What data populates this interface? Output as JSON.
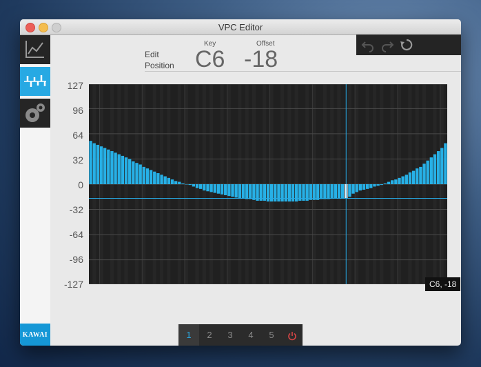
{
  "window": {
    "title": "VPC Editor"
  },
  "header": {
    "edit_label_line1": "Edit",
    "edit_label_line2": "Position",
    "key_label": "Key",
    "key_value": "C6",
    "offset_label": "Offset",
    "offset_value": "-18"
  },
  "sidebar": {
    "items": [
      {
        "icon": "line-graph-icon",
        "active": false
      },
      {
        "icon": "bar-edit-icon",
        "active": true
      },
      {
        "icon": "settings-gears-icon",
        "active": false
      }
    ],
    "logo": "KAWAI"
  },
  "toolbar": {
    "buttons": [
      {
        "icon": "undo-icon"
      },
      {
        "icon": "redo-icon"
      },
      {
        "icon": "reset-icon"
      }
    ]
  },
  "tooltip": "C6, -18",
  "pager": {
    "pages": [
      "1",
      "2",
      "3",
      "4",
      "5"
    ],
    "active": "1",
    "power_icon": "power-icon"
  },
  "colors": {
    "accent": "#27a9e3",
    "plot_bg": "#202020",
    "bar": "#27b0e6",
    "selected_bar": "#ffffff"
  },
  "chart_data": {
    "type": "bar",
    "ylim": [
      -127,
      127
    ],
    "y_ticks": [
      "127",
      "96",
      "64",
      "32",
      "0",
      "-32",
      "-64",
      "-96",
      "-127"
    ],
    "selected_index": 72,
    "values": [
      55,
      52,
      50,
      48,
      46,
      44,
      42,
      40,
      38,
      36,
      34,
      32,
      29,
      27,
      25,
      22,
      20,
      18,
      16,
      14,
      12,
      10,
      8,
      6,
      4,
      3,
      1,
      0,
      -1,
      -3,
      -5,
      -6,
      -8,
      -9,
      -10,
      -11,
      -12,
      -13,
      -14,
      -15,
      -16,
      -17,
      -18,
      -18,
      -19,
      -19,
      -20,
      -21,
      -21,
      -21,
      -22,
      -22,
      -22,
      -22,
      -22,
      -22,
      -22,
      -22,
      -22,
      -21,
      -21,
      -21,
      -20,
      -20,
      -20,
      -19,
      -19,
      -19,
      -18,
      -18,
      -18,
      -18,
      -18,
      -16,
      -12,
      -10,
      -8,
      -7,
      -6,
      -5,
      -3,
      -2,
      -1,
      1,
      3,
      5,
      6,
      8,
      10,
      12,
      15,
      17,
      20,
      22,
      26,
      30,
      34,
      38,
      42,
      46,
      52
    ]
  }
}
